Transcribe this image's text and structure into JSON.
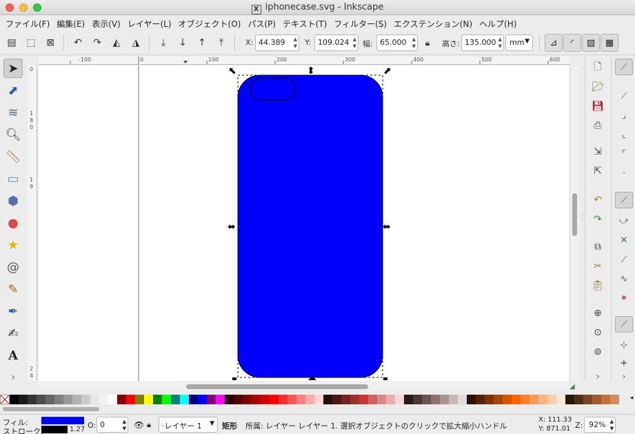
{
  "window": {
    "title": "iphonecase.svg - Inkscape"
  },
  "menu": [
    "ファイル(F)",
    "編集(E)",
    "表示(V)",
    "レイヤー(L)",
    "オブジェクト(O)",
    "パス(P)",
    "テキスト(T)",
    "フィルター(S)",
    "エクステンション(N)",
    "ヘルプ(H)"
  ],
  "controls": {
    "x_label": "X:",
    "x_value": "44.389",
    "y_label": "Y:",
    "y_value": "109.024",
    "w_label": "幅:",
    "w_value": "65.000",
    "h_label": "高さ:",
    "h_value": "135.000",
    "unit": "mm"
  },
  "ruler": {
    "top_ticks": [
      "-100",
      "0",
      "100",
      "200",
      "300",
      "400",
      "500",
      "600"
    ],
    "left_ticks": [
      "0",
      "1",
      "8",
      "0",
      "1",
      "9",
      "2",
      "4"
    ]
  },
  "canvas": {
    "fill_color": "#0000ff",
    "stroke_color": "#000000"
  },
  "palette": [
    "#000000",
    "#1a1a1a",
    "#333333",
    "#4d4d4d",
    "#666666",
    "#808080",
    "#999999",
    "#b3b3b3",
    "#cccccc",
    "#e6e6e6",
    "#f2f2f2",
    "#ffffff",
    "#800000",
    "#ff0000",
    "#808000",
    "#ffff00",
    "#008000",
    "#00ff00",
    "#008080",
    "#00ffff",
    "#000080",
    "#0000ff",
    "#800080",
    "#ff00ff",
    "#2b0000",
    "#550000",
    "#800000",
    "#aa0000",
    "#d40000",
    "#ff0000",
    "#ff2a2a",
    "#ff5555",
    "#ff8080",
    "#ffaaaa",
    "#ffd5d5",
    "#280b0b",
    "#501616",
    "#782121",
    "#a02c2c",
    "#c83737",
    "#d35f5f",
    "#de8787",
    "#e9afaf",
    "#f4d7d7",
    "#241c1c",
    "#483737",
    "#6c5353",
    "#916f6f",
    "#ac9393",
    "#c8b7b7",
    "#e3dbdb",
    "#2b1100",
    "#552200",
    "#803300",
    "#aa4400",
    "#d45500",
    "#ff6600",
    "#ff7f2a",
    "#ff9955",
    "#ffb380",
    "#ffccaa",
    "#ffe6d5",
    "#28170b",
    "#502d16",
    "#784421",
    "#a05a2c",
    "#c87137",
    "#d38d5f"
  ],
  "status": {
    "fill_label": "フィル:",
    "stroke_label": "ストローク:",
    "stroke_width": "1.27",
    "opacity_label": "O:",
    "opacity_value": "0",
    "layer": "·レイヤー 1",
    "object_type": "矩形",
    "message": "所属: レイヤー レイヤー 1. 選択オブジェクトのクリックで拡大縮小ハンドル",
    "x_coord": "X:  111.33",
    "y_coord": "Y:  871.01",
    "zoom_label": "Z:",
    "zoom": "92%"
  }
}
